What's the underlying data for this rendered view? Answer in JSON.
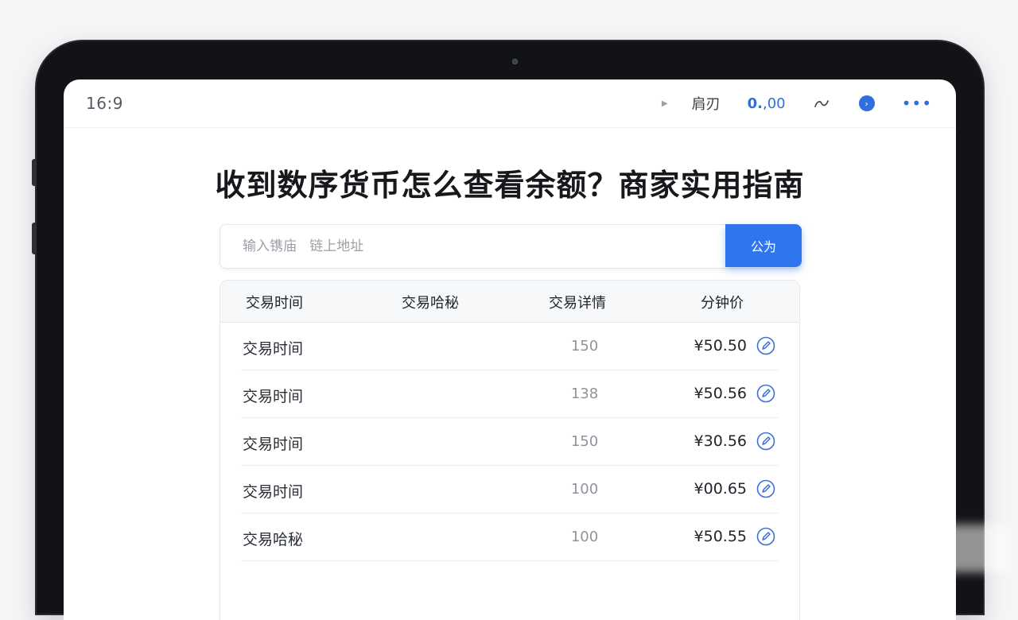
{
  "status_bar": {
    "time": "16:9",
    "play_icon": "play-small-icon",
    "label": "肩刃",
    "balance_bold": "0.",
    "balance_rest": ",00",
    "icons": [
      "swirl-icon",
      "next-circle-icon",
      "more-dots-icon"
    ],
    "next_glyph": "›",
    "more_glyph": "•••"
  },
  "page": {
    "title": "收到数序货币怎么查看余额？商家实用指南"
  },
  "search": {
    "placeholder": "输入镌庙   链上地址",
    "button_label": "公为"
  },
  "table": {
    "headers": [
      "交易时间",
      "交易哈秘",
      "交易详情",
      "分钟价"
    ],
    "rows": [
      {
        "name": "交易时间",
        "qty": "150",
        "price": "¥50.50"
      },
      {
        "name": "交易时间",
        "qty": "138",
        "price": "¥50.56"
      },
      {
        "name": "交易时间",
        "qty": "150",
        "price": "¥30.56"
      },
      {
        "name": "交易时间",
        "qty": "100",
        "price": "¥00.65"
      },
      {
        "name": "交易哈秘",
        "qty": "100",
        "price": "¥50.55"
      }
    ]
  },
  "colors": {
    "accent": "#2f76ee",
    "title_text": "#16181c",
    "muted_text": "#8f949b"
  }
}
